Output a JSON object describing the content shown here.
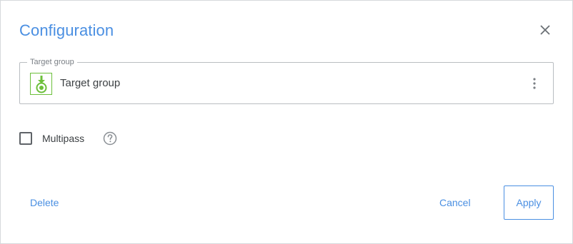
{
  "dialog": {
    "title": "Configuration",
    "close_icon": "close-icon"
  },
  "target_field": {
    "legend": "Target group",
    "value": "Target group",
    "icon": "target-group-icon",
    "menu_icon": "more-vert-icon"
  },
  "multipass": {
    "label": "Multipass",
    "checked": false,
    "help_icon": "help-circle-icon"
  },
  "footer": {
    "delete_label": "Delete",
    "cancel_label": "Cancel",
    "apply_label": "Apply"
  },
  "colors": {
    "accent": "#4a8fe2",
    "icon_green": "#6cbf3b",
    "border": "#b9bdc1"
  }
}
